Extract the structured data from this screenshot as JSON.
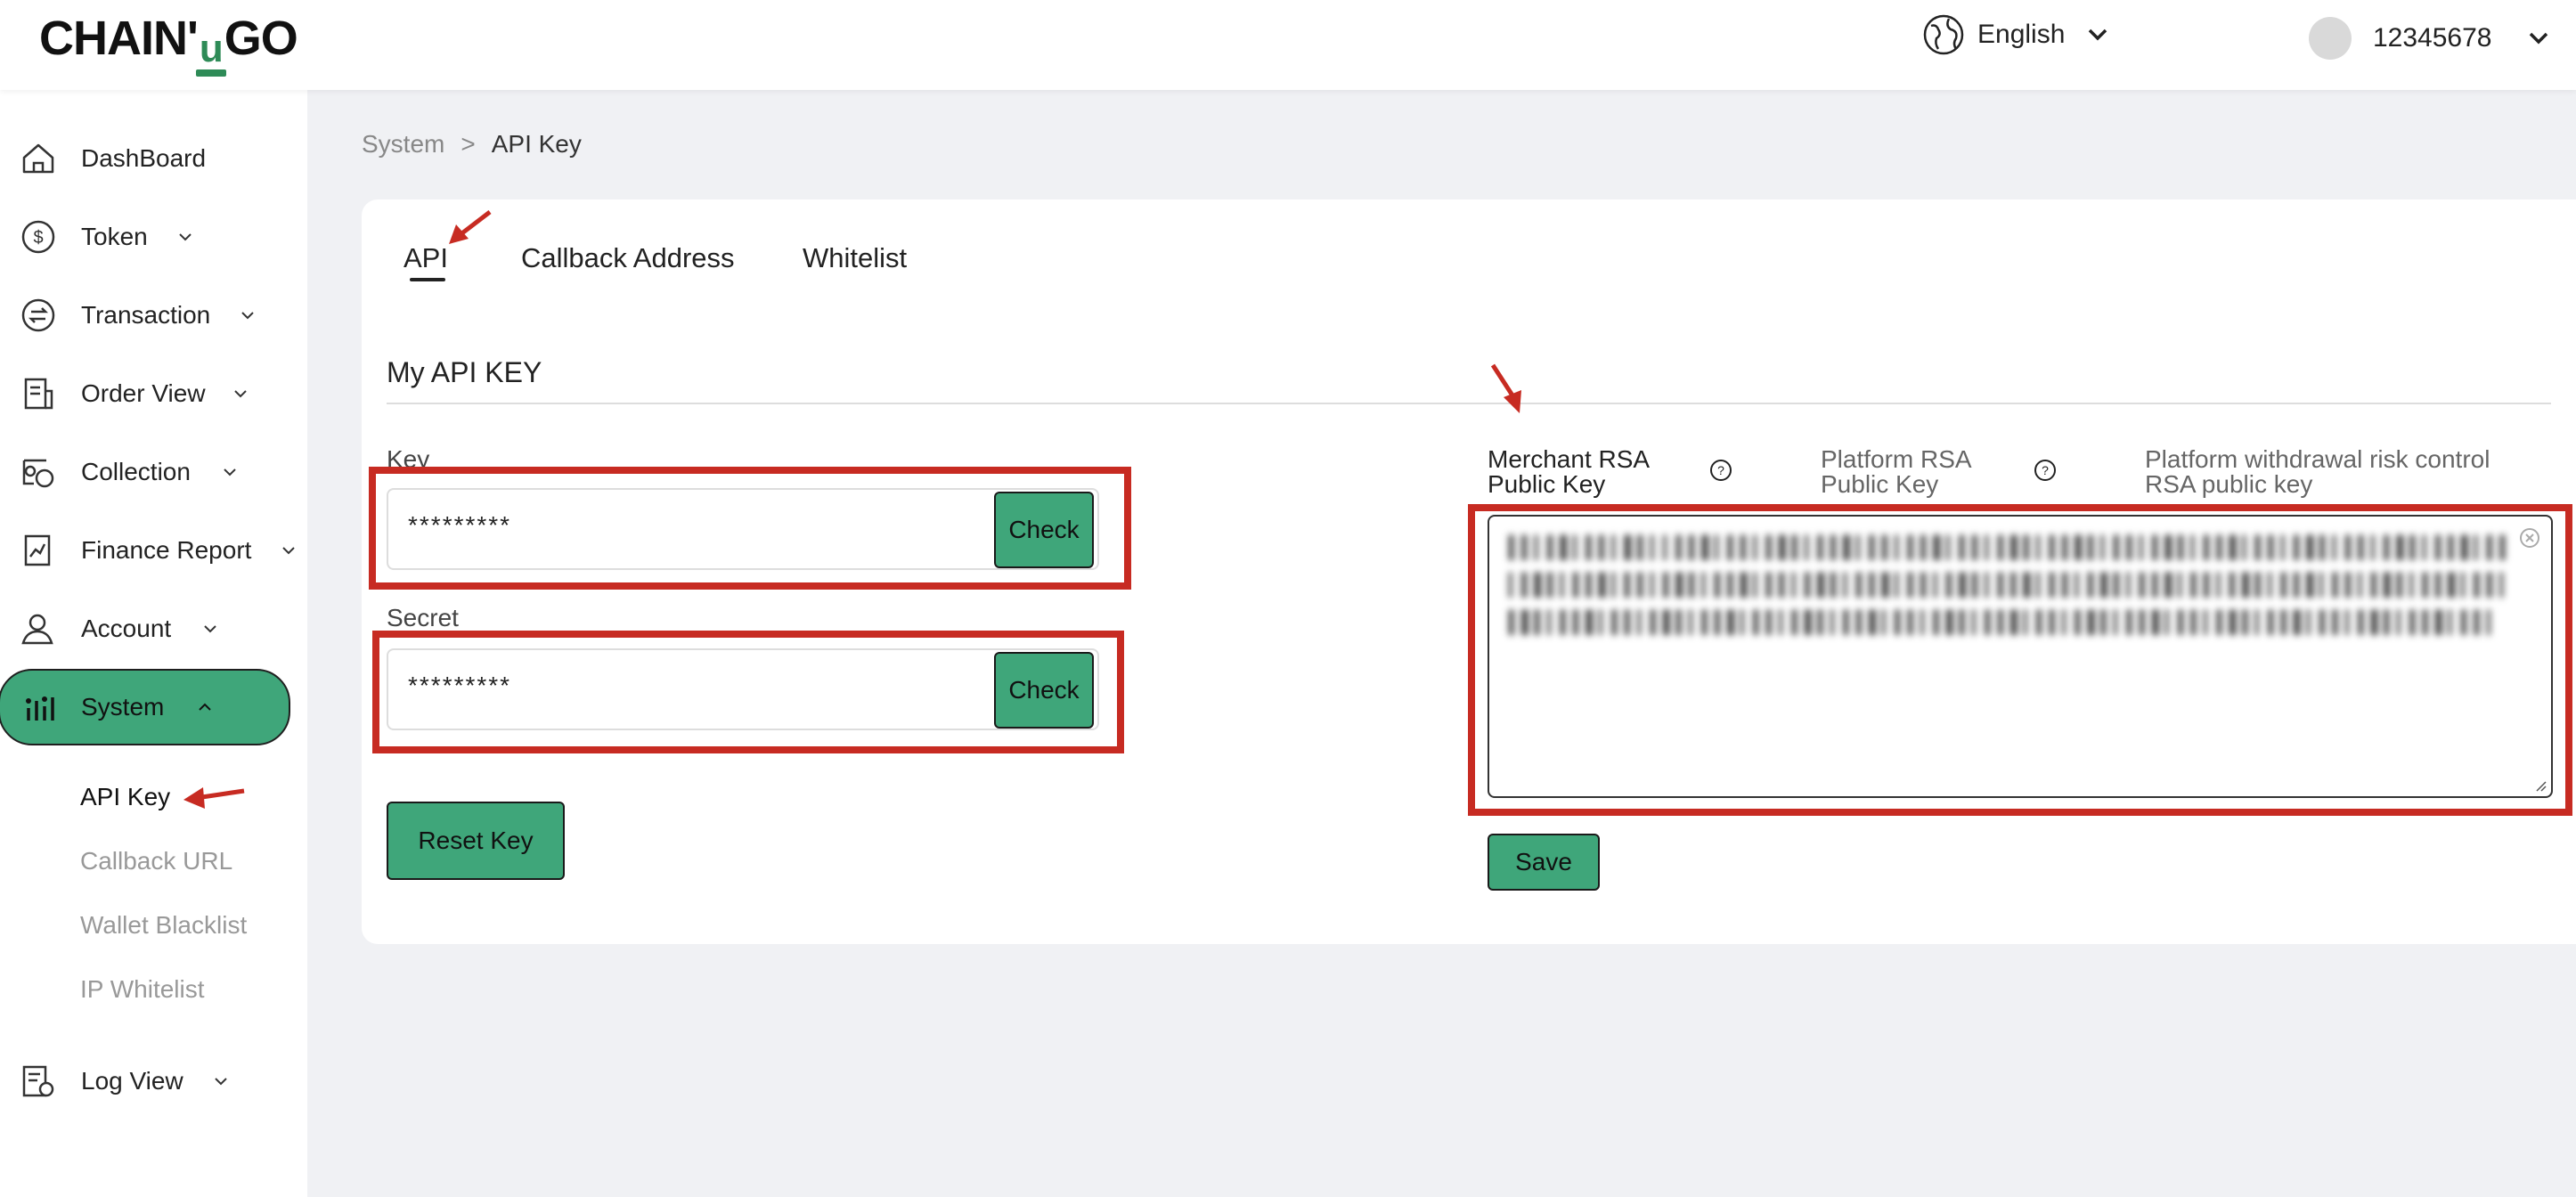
{
  "header": {
    "logo": "CHAIN'uGO",
    "language": "English",
    "user_id": "12345678"
  },
  "sidebar": {
    "items": [
      {
        "label": "DashBoard",
        "icon": "home-icon"
      },
      {
        "label": "Token",
        "icon": "dollar-circle-icon"
      },
      {
        "label": "Transaction",
        "icon": "exchange-icon"
      },
      {
        "label": "Order View",
        "icon": "document-icon"
      },
      {
        "label": "Collection",
        "icon": "collection-icon"
      },
      {
        "label": "Finance Report",
        "icon": "report-icon"
      },
      {
        "label": "Account",
        "icon": "user-icon"
      },
      {
        "label": "System",
        "icon": "bar-chart-icon"
      },
      {
        "label": "Log View",
        "icon": "log-icon"
      }
    ],
    "system_sub": [
      "API Key",
      "Callback URL",
      "Wallet Blacklist",
      "IP Whitelist"
    ]
  },
  "breadcrumb": {
    "root": "System",
    "separator": ">",
    "current": "API Key"
  },
  "tabs": [
    "API",
    "Callback Address",
    "Whitelist"
  ],
  "main": {
    "section_title": "My API KEY",
    "key_label": "Key",
    "key_value": "*********",
    "secret_label": "Secret",
    "secret_value": "*********",
    "check_label": "Check",
    "reset_label": "Reset Key",
    "rsa_labels": {
      "merchant_line1": "Merchant RSA",
      "merchant_line2": "Public Key",
      "platform_line1": "Platform RSA",
      "platform_line2": "Public Key",
      "withdraw_line1": "Platform withdrawal risk control",
      "withdraw_line2": "RSA public key"
    },
    "save_label": "Save"
  },
  "colors": {
    "accent": "#3fa67a",
    "annotation": "#c72b22"
  }
}
